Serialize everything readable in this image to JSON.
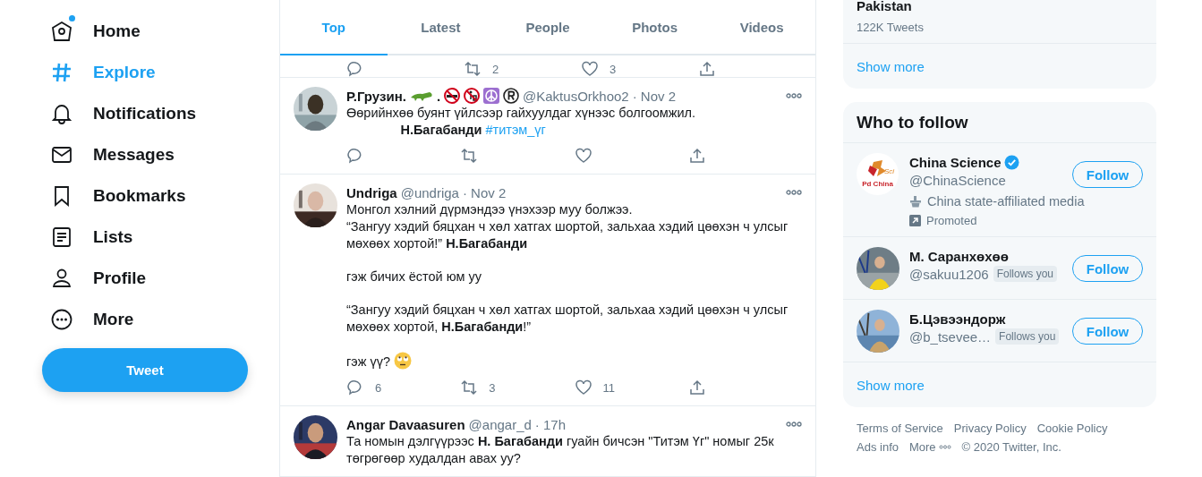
{
  "nav": {
    "items": [
      {
        "label": "Home",
        "selected": false,
        "badge": true
      },
      {
        "label": "Explore",
        "selected": true,
        "badge": false
      },
      {
        "label": "Notifications",
        "selected": false,
        "badge": false
      },
      {
        "label": "Messages",
        "selected": false,
        "badge": false
      },
      {
        "label": "Bookmarks",
        "selected": false,
        "badge": false
      },
      {
        "label": "Lists",
        "selected": false,
        "badge": false
      },
      {
        "label": "Profile",
        "selected": false,
        "badge": false
      },
      {
        "label": "More",
        "selected": false,
        "badge": false
      }
    ],
    "tweet_button": "Tweet"
  },
  "tabs": [
    {
      "label": "Top",
      "selected": true
    },
    {
      "label": "Latest",
      "selected": false
    },
    {
      "label": "People",
      "selected": false
    },
    {
      "label": "Photos",
      "selected": false
    },
    {
      "label": "Videos",
      "selected": false
    }
  ],
  "feed": {
    "partial_actions": {
      "retweets": "2",
      "likes": "3"
    },
    "tweets": [
      {
        "name": "Р.Грузин.",
        "name_tail": ".",
        "name_emojis": true,
        "handle": "@KaktusOrkhoo2",
        "time": "· Nov 2",
        "body": [
          "Өөрийнхөө буянт үйлсээр гайхуулдаг хүнээс болгоомжил.\n               **Н.Багабанди** "
        ],
        "hashtag": "#титэм_үг"
      },
      {
        "name": "Undriga",
        "handle": "@undriga",
        "time": "· Nov 2",
        "body": [
          "Монгол хэлний дүрмэндээ үнэхээр муу болжээ.\n“Зангуу хэдий бяцхан ч хөл хатгах шортой, зальхаа хэдий цөөхэн ч улсыг мөхөөх хортой!” **Н.Багабанди**",
          "гэж бичих ёстой юм уу",
          "“Зангуу хэдий бяцхан ч хөл хатгах шортой, зальхаа хэдий цөөхэн ч улсыг мөхөөх хортой, **Н.Багабанди**!”",
          "гэж үү?"
        ],
        "trailing_emoji": true,
        "actions": {
          "replies": "6",
          "retweets": "3",
          "likes": "11"
        }
      },
      {
        "name": "Angar Davaasuren",
        "handle": "@angar_d",
        "time": "· 17h",
        "body": [
          "Та номын дэлгүүрээс **Н. Багабанди** гуайн бичсэн \"Титэм Үг\" номыг 25к төгрөгөөр худалдан авах уу?"
        ],
        "partial": true
      }
    ]
  },
  "trends": {
    "name": "Pakistan",
    "count": "122K Tweets",
    "show_more": "Show more"
  },
  "who_to_follow": {
    "title": "Who to follow",
    "accounts": [
      {
        "name": "China Science",
        "verified": true,
        "handle": "@ChinaScience",
        "affiliation": "China state-affiliated media",
        "promoted": "Promoted",
        "logo": [
          "Sci",
          "Pd China"
        ],
        "button": "Follow"
      },
      {
        "name": "М. Саранхөхөө",
        "handle": "@sakuu1206",
        "follows_you": true,
        "follows_label": "Follows you",
        "button": "Follow"
      },
      {
        "name": "Б.Цэвээндорж",
        "handle": "@b_tsevee…",
        "follows_you": true,
        "follows_label": "Follows you",
        "button": "Follow"
      }
    ],
    "show_more": "Show more"
  },
  "footer": [
    {
      "kind": "link",
      "text": "Terms of Service"
    },
    {
      "kind": "link",
      "text": "Privacy Policy"
    },
    {
      "kind": "link",
      "text": "Cookie Policy"
    },
    {
      "kind": "link",
      "text": "Ads info"
    },
    {
      "kind": "more",
      "text": "More"
    },
    {
      "kind": "copyright",
      "text": "© 2020 Twitter, Inc."
    }
  ]
}
